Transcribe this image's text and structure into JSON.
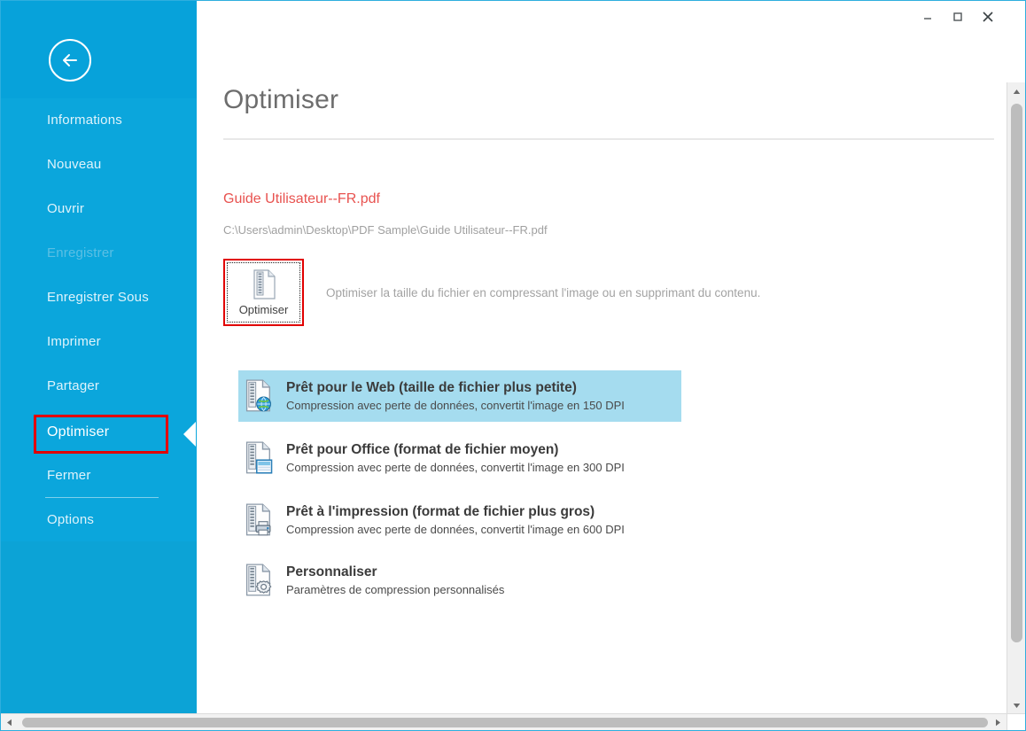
{
  "window": {
    "controls": [
      {
        "name": "minimize",
        "glyph": "–"
      },
      {
        "name": "maximize",
        "glyph": "☐"
      },
      {
        "name": "close",
        "glyph": "✕"
      }
    ]
  },
  "sidebar": {
    "back_icon": "back-arrow-icon",
    "accent_color": "#0ca3d6",
    "highlight_border_color": "#e10000",
    "items": [
      {
        "label": "Informations",
        "state": "normal"
      },
      {
        "label": "Nouveau",
        "state": "normal"
      },
      {
        "label": "Ouvrir",
        "state": "normal"
      },
      {
        "label": "Enregistrer",
        "state": "disabled"
      },
      {
        "label": "Enregistrer Sous",
        "state": "normal"
      },
      {
        "label": "Imprimer",
        "state": "normal"
      },
      {
        "label": "Partager",
        "state": "normal"
      },
      {
        "label": "Optimiser",
        "state": "active"
      },
      {
        "label": "Fermer",
        "state": "normal"
      },
      {
        "label": "Options",
        "state": "normal"
      }
    ]
  },
  "main": {
    "title": "Optimiser",
    "file_name": "Guide Utilisateur--FR.pdf",
    "file_name_color": "#e8524f",
    "file_path": "C:\\Users\\admin\\Desktop\\PDF Sample\\Guide Utilisateur--FR.pdf",
    "optimize_button": {
      "label": "Optimiser",
      "icon": "zipped-document-icon",
      "border_color": "#e10000"
    },
    "optimize_description": "Optimiser la taille du fichier en compressant l'image ou en supprimant du contenu.",
    "options": [
      {
        "title": "Prêt pour le Web (taille de fichier plus petite)",
        "subtitle": "Compression avec perte de données, convertit l'image en 150 DPI",
        "icon": "zipped-document-web-icon",
        "selected": true
      },
      {
        "title": "Prêt pour Office (format de fichier moyen)",
        "subtitle": "Compression avec perte de données, convertit l'image en 300 DPI",
        "icon": "zipped-document-office-icon",
        "selected": false
      },
      {
        "title": "Prêt à l'impression (format de fichier plus gros)",
        "subtitle": "Compression avec perte de données, convertit l'image en 600 DPI",
        "icon": "zipped-document-print-icon",
        "selected": false
      },
      {
        "title": "Personnaliser",
        "subtitle": "Paramètres de compression personnalisés",
        "icon": "zipped-document-settings-icon",
        "selected": false
      }
    ],
    "selection_highlight_color": "#a5dcef"
  },
  "scrollbars": {
    "vertical": {
      "up_arrow": "▲",
      "down_arrow": "▼"
    },
    "horizontal": {
      "left_arrow": "◀",
      "right_arrow": "▶"
    }
  }
}
